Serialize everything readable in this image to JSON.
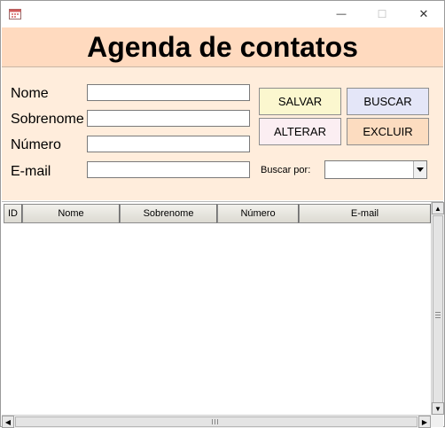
{
  "window": {
    "minimize_glyph": "—",
    "maximize_glyph": "☐",
    "close_glyph": "✕"
  },
  "heading": "Agenda de contatos",
  "form": {
    "fields": [
      {
        "label": "Nome",
        "value": ""
      },
      {
        "label": "Sobrenome",
        "value": ""
      },
      {
        "label": "Número",
        "value": ""
      },
      {
        "label": "E-mail",
        "value": ""
      }
    ],
    "buttons": {
      "salvar": "SALVAR",
      "buscar": "BUSCAR",
      "alterar": "ALTERAR",
      "excluir": "EXCLUIR"
    },
    "search": {
      "label": "Buscar por:",
      "selected": ""
    }
  },
  "table": {
    "columns": [
      "ID",
      "Nome",
      "Sobrenome",
      "Número",
      "E-mail"
    ],
    "rows": []
  },
  "scroll_glyphs": {
    "up": "▲",
    "down": "▼",
    "left": "◀",
    "right": "▶"
  },
  "colors": {
    "heading_bg": "#ffdabf",
    "form_bg": "#ffeddc",
    "salvar_bg": "#fbf7cf",
    "buscar_bg": "#e4e6f8",
    "alterar_bg": "#fbeef2",
    "excluir_bg": "#fcdcc0"
  }
}
